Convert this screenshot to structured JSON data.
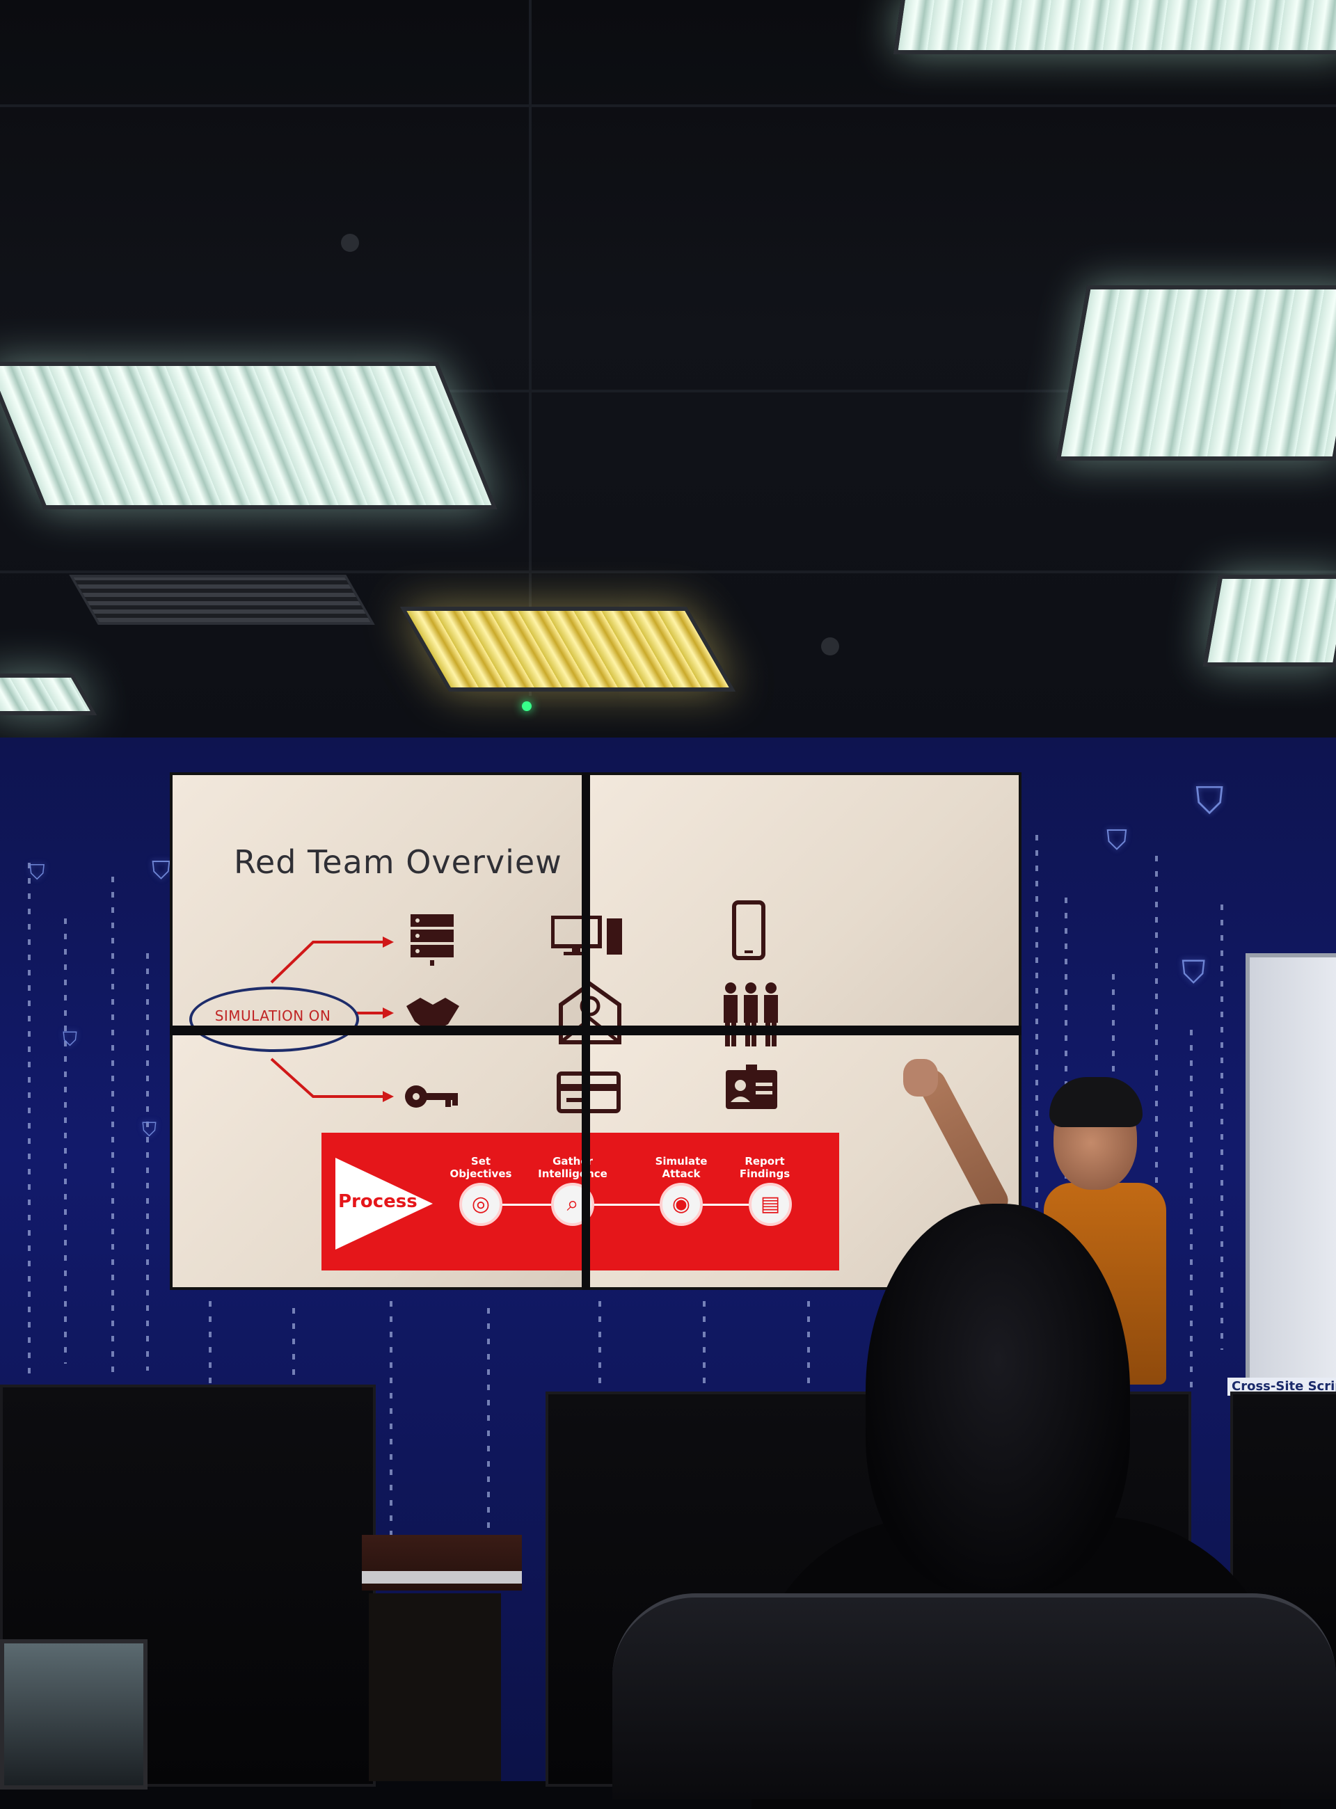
{
  "slide": {
    "title": "Red Team Overview",
    "ellipse_label": "SIMULATION ON",
    "process_label": "Process",
    "steps": [
      {
        "label": "Set Objectives",
        "icon": "lightbulb-icon"
      },
      {
        "label": "Gather Intelligence",
        "icon": "magnifier-icon"
      },
      {
        "label": "Simulate Attack",
        "icon": "target-icon"
      },
      {
        "label": "Report Findings",
        "icon": "document-icon"
      }
    ],
    "target_icons": [
      "server-icon",
      "computer-icon",
      "phone-icon",
      "handshake-icon",
      "email-icon",
      "people-icon",
      "key-icon",
      "card-icon",
      "id-badge-icon"
    ],
    "accent_color": "#e5161a"
  },
  "whiteboard": {
    "label": "Cross-Site Scripting"
  }
}
